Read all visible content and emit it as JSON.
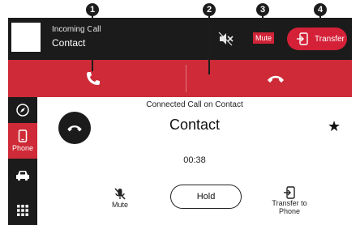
{
  "header": {
    "incoming_label": "Incoming Call",
    "contact_name": "Contact",
    "mute_label": "Mute",
    "transfer_label": "Transfer"
  },
  "callouts": [
    "1",
    "2",
    "3",
    "4"
  ],
  "nav": {
    "phone_label": "Phone"
  },
  "call": {
    "status_title": "Connected Call on Contact",
    "contact_name": "Contact",
    "duration": "00:38"
  },
  "controls": {
    "mute_label": "Mute",
    "hold_label": "Hold",
    "transfer_phone_label": "Transfer to Phone"
  },
  "colors": {
    "accent_red": "#ce2a37",
    "dark_bar": "#1b1b1b",
    "background": "#ffffff"
  },
  "icons": {
    "answer": "phone-handset-icon",
    "decline": "hang-up-icon",
    "speaker_mute": "speaker-muted-icon",
    "transfer": "transfer-icon",
    "compass": "compass-icon",
    "phone": "phone-icon",
    "car": "car-icon",
    "apps": "grid-icon",
    "favorite": "star-icon",
    "mic_mute": "mic-muted-icon"
  }
}
